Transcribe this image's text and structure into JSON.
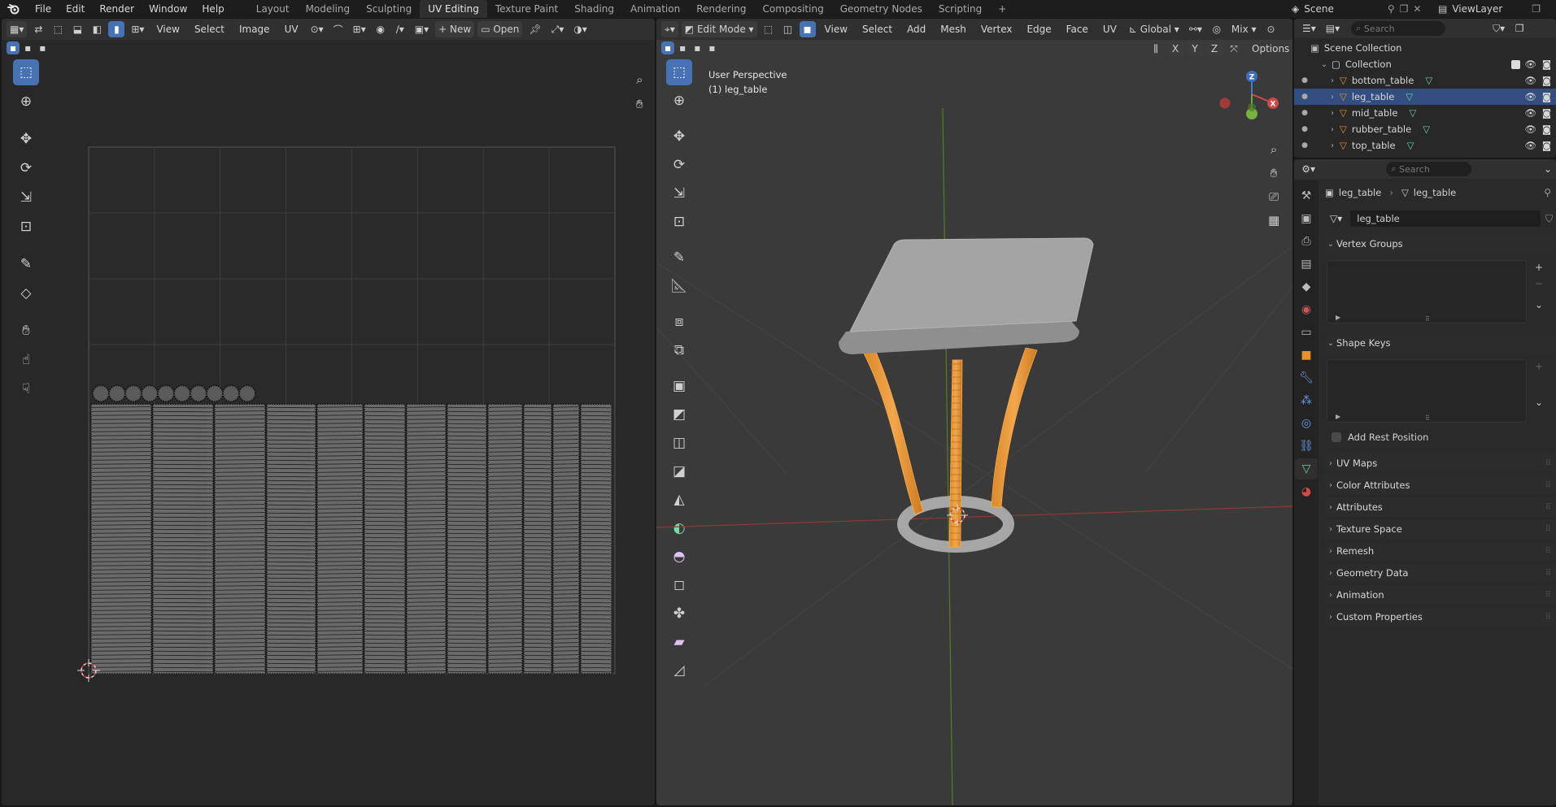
{
  "topbar": {
    "menus": [
      "File",
      "Edit",
      "Render",
      "Window",
      "Help"
    ],
    "workspaces": [
      "Layout",
      "Modeling",
      "Sculpting",
      "UV Editing",
      "Texture Paint",
      "Shading",
      "Animation",
      "Rendering",
      "Compositing",
      "Geometry Nodes",
      "Scripting"
    ],
    "active_workspace": "UV Editing",
    "add_tab": "+",
    "scene_label": "Scene",
    "viewlayer_label": "ViewLayer"
  },
  "uv_editor": {
    "menus": [
      "View",
      "Select",
      "Image",
      "UV"
    ],
    "new_label": "New",
    "open_label": "Open",
    "grid_fill_percent": 0.62
  },
  "viewport": {
    "mode_label": "Edit Mode",
    "menus": [
      "View",
      "Select",
      "Add",
      "Mesh",
      "Vertex",
      "Edge",
      "Face",
      "UV"
    ],
    "transform_orientation": "Global",
    "mix_label": "Mix",
    "axis_buttons": [
      "X",
      "Y",
      "Z"
    ],
    "options_label": "Options",
    "overlay_title": "User Perspective",
    "overlay_object": "(1) leg_table",
    "gizmo_labels": [
      "X",
      "Y",
      "Z"
    ]
  },
  "outliner": {
    "search_placeholder": "Search",
    "scene_collection": "Scene Collection",
    "collection": "Collection",
    "objects": [
      "bottom_table",
      "leg_table",
      "mid_table",
      "rubber_table",
      "top_table"
    ],
    "selected_object": "leg_table"
  },
  "properties": {
    "search_placeholder": "Search",
    "breadcrumb_object": "leg_table",
    "breadcrumb_mesh": "leg_table",
    "mesh_name": "leg_table",
    "vertex_groups": "Vertex Groups",
    "shape_keys": "Shape Keys",
    "add_rest_position": "Add Rest Position",
    "collapsed_panels": [
      "UV Maps",
      "Color Attributes",
      "Attributes",
      "Texture Space",
      "Remesh",
      "Geometry Data",
      "Animation",
      "Custom Properties"
    ]
  }
}
